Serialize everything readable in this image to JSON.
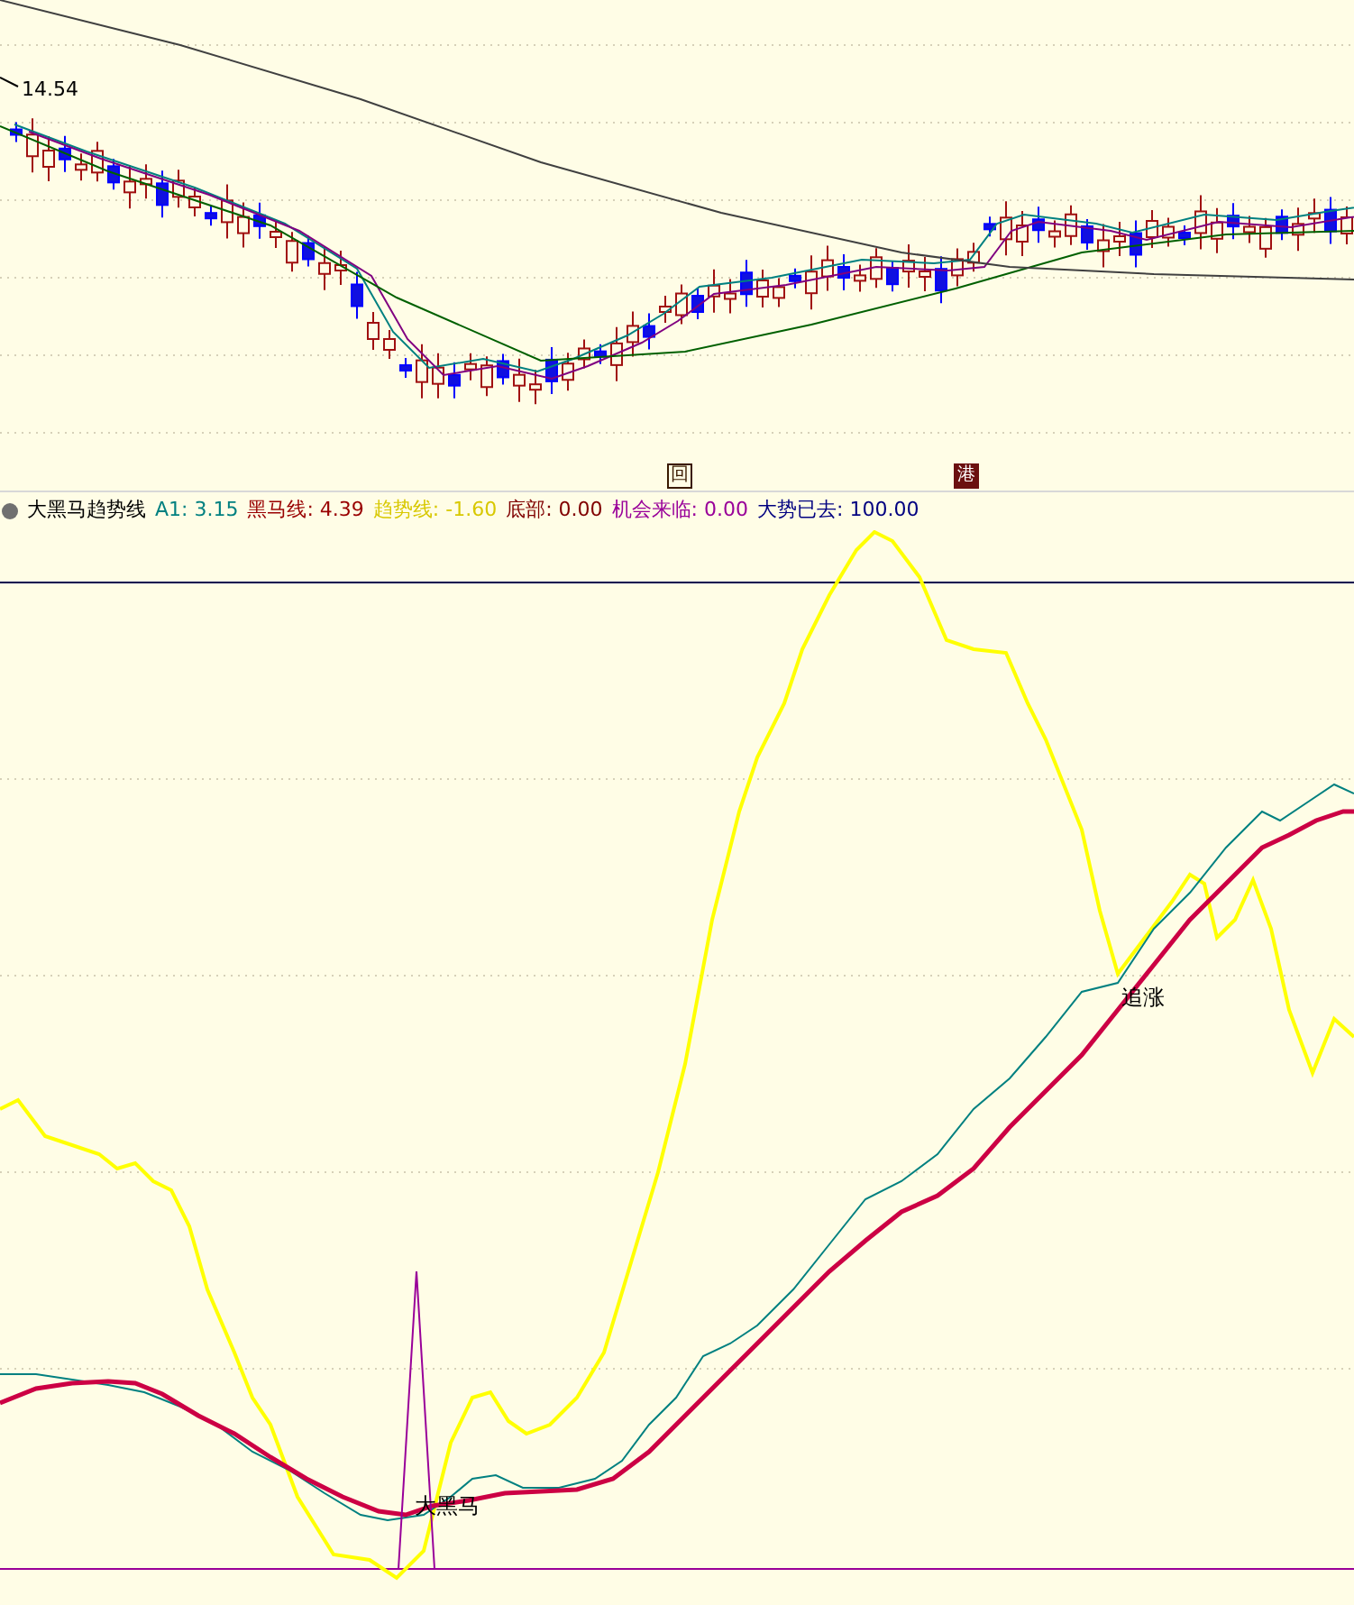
{
  "price_panel": {
    "price_label": "14.54",
    "markers": [
      {
        "text": "回",
        "kind": "outline"
      },
      {
        "text": "港",
        "kind": "filled"
      }
    ]
  },
  "legend": {
    "title": "大黑马趋势线",
    "items": [
      {
        "text": "A1: 3.15",
        "color": "#008080"
      },
      {
        "text": "黑马线: 4.39",
        "color": "#990000"
      },
      {
        "text": "趋势线: -1.60",
        "color": "#d8c800"
      },
      {
        "text": "底部: 0.00",
        "color": "#800000"
      },
      {
        "text": "机会来临: 0.00",
        "color": "#990099"
      },
      {
        "text": "大势已去: 100.00",
        "color": "#000080"
      }
    ]
  },
  "indicator_panel": {
    "labels": [
      {
        "text": "追涨",
        "kind": "chase"
      },
      {
        "text": "大黑马",
        "kind": "signal"
      }
    ]
  }
}
